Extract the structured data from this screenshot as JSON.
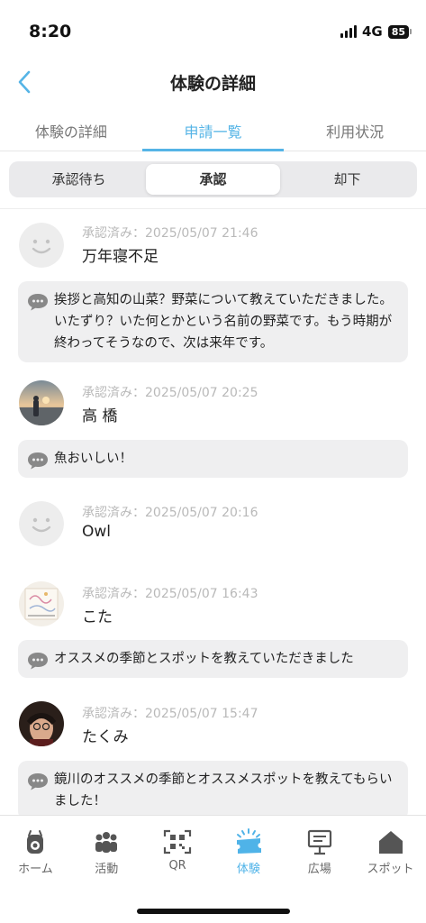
{
  "status_bar": {
    "time": "8:20",
    "network": "4G",
    "battery": "85"
  },
  "header": {
    "title": "体験の詳細"
  },
  "tabs": [
    {
      "label": "体験の詳細",
      "active": false
    },
    {
      "label": "申請一覧",
      "active": true
    },
    {
      "label": "利用状況",
      "active": false
    }
  ],
  "segments": [
    {
      "label": "承認待ち",
      "active": false
    },
    {
      "label": "承認",
      "active": true
    },
    {
      "label": "却下",
      "active": false
    }
  ],
  "entries": [
    {
      "meta": "承認済み：2025/05/07 21:46",
      "name": "万年寝不足",
      "avatar": "smiley-avatar",
      "comment": "挨拶と高知の山菜？野菜について教えていただきました。いたずり？いた何とかという名前の野菜です。もう時期が終わってそうなので、次は来年です。"
    },
    {
      "meta": "承認済み：2025/05/07 20:25",
      "name": "高 橋",
      "avatar": "photo-avatar-beach",
      "comment": "魚おいしい！"
    },
    {
      "meta": "承認済み：2025/05/07 20:16",
      "name": "Owl",
      "avatar": "smiley-avatar",
      "comment": ""
    },
    {
      "meta": "承認済み：2025/05/07 16:43",
      "name": "こた",
      "avatar": "photo-avatar-drawing",
      "comment": "オススメの季節とスポットを教えていただきました"
    },
    {
      "meta": "承認済み：2025/05/07 15:47",
      "name": "たくみ",
      "avatar": "photo-avatar-portrait",
      "comment": "鏡川のオススメの季節とオススメスポットを教えてもらいました！"
    }
  ],
  "bottom_nav": [
    {
      "label": "ホーム",
      "icon": "home-mascot-icon",
      "active": false
    },
    {
      "label": "活動",
      "icon": "people-icon",
      "active": false
    },
    {
      "label": "QR",
      "icon": "qr-scan-icon",
      "active": false
    },
    {
      "label": "体験",
      "icon": "ticket-icon",
      "active": true
    },
    {
      "label": "広場",
      "icon": "signboard-icon",
      "active": false
    },
    {
      "label": "スポット",
      "icon": "house-icon",
      "active": false
    }
  ],
  "colors": {
    "accent": "#55b4e6",
    "bubble": "#efeff0",
    "meta": "#b9b9b9"
  }
}
